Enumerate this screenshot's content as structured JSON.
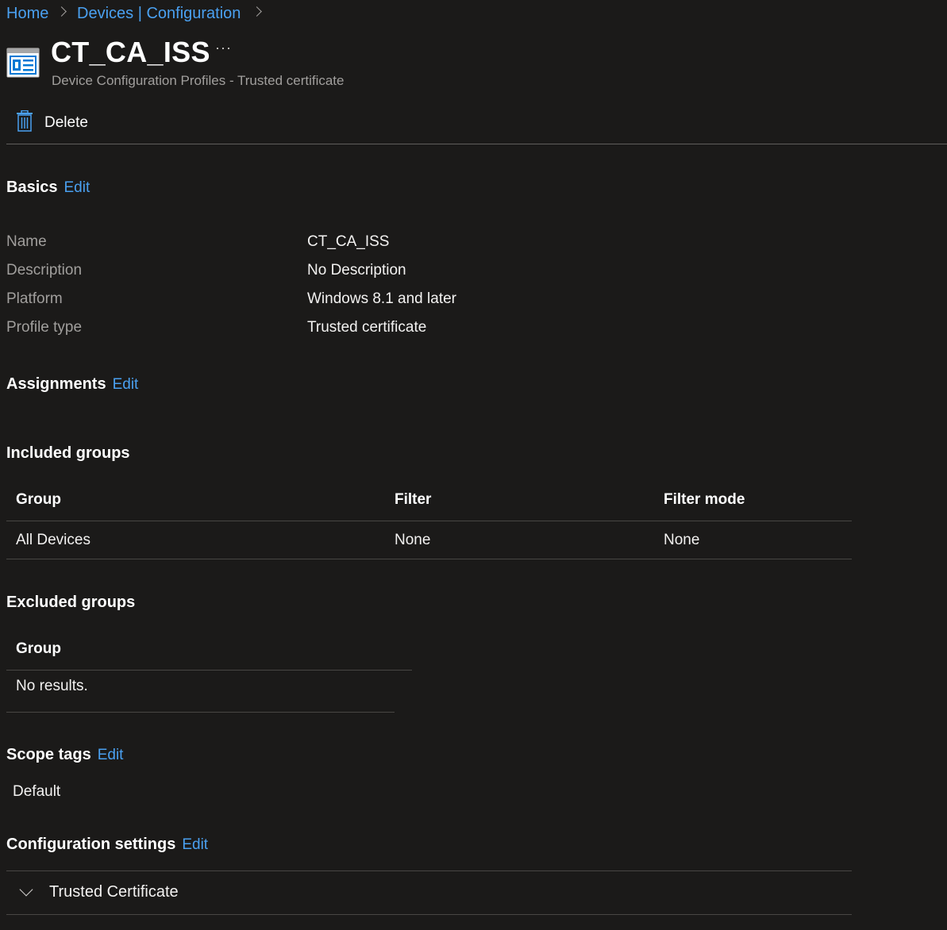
{
  "breadcrumb": {
    "items": [
      "Home",
      "Devices | Configuration"
    ]
  },
  "header": {
    "title": "CT_CA_ISS",
    "more_label": "···",
    "subtitle": "Device Configuration Profiles - Trusted certificate"
  },
  "toolbar": {
    "delete_label": "Delete"
  },
  "basics": {
    "heading": "Basics",
    "edit_label": "Edit",
    "rows": [
      {
        "label": "Name",
        "value": "CT_CA_ISS"
      },
      {
        "label": "Description",
        "value": "No Description"
      },
      {
        "label": "Platform",
        "value": "Windows 8.1 and later"
      },
      {
        "label": "Profile type",
        "value": "Trusted certificate"
      }
    ]
  },
  "assignments": {
    "heading": "Assignments",
    "edit_label": "Edit",
    "included": {
      "heading": "Included groups",
      "columns": [
        "Group",
        "Filter",
        "Filter mode"
      ],
      "rows": [
        [
          "All Devices",
          "None",
          "None"
        ]
      ]
    },
    "excluded": {
      "heading": "Excluded groups",
      "columns": [
        "Group"
      ],
      "empty_text": "No results."
    }
  },
  "scope_tags": {
    "heading": "Scope tags",
    "edit_label": "Edit",
    "value": "Default"
  },
  "configuration_settings": {
    "heading": "Configuration settings",
    "edit_label": "Edit",
    "expander_label": "Trusted Certificate"
  },
  "colors": {
    "background": "#1b1a19",
    "link": "#4aa0f0",
    "accent_icon": "#0078d4"
  }
}
